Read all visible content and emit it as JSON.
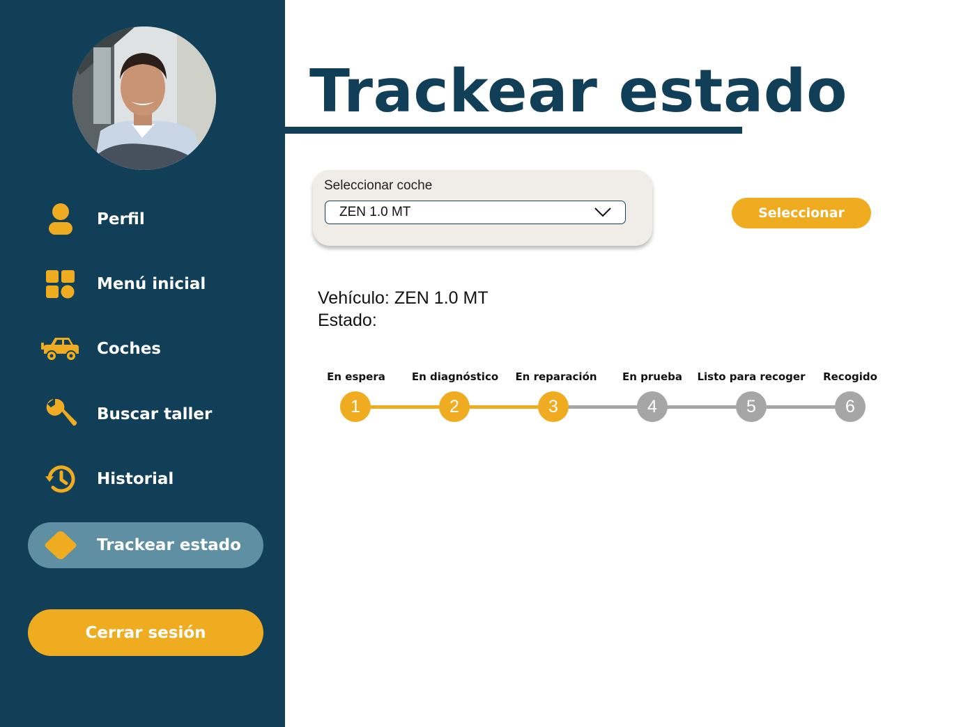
{
  "colors": {
    "sidebar_bg": "#113f57",
    "accent": "#f0ac20",
    "active_item_bg": "#5e8fa3",
    "title": "#113f57",
    "step_inactive": "#a6a6a6"
  },
  "sidebar": {
    "avatar_icon": "driver-photo",
    "items": [
      {
        "label": "Perfil",
        "icon": "user-icon",
        "active": false
      },
      {
        "label": "Menú inicial",
        "icon": "grid-icon",
        "active": false
      },
      {
        "label": "Coches",
        "icon": "car-icon",
        "active": false
      },
      {
        "label": "Buscar taller",
        "icon": "wrench-icon",
        "active": false
      },
      {
        "label": "Historial",
        "icon": "history-icon",
        "active": false
      },
      {
        "label": "Trackear estado",
        "icon": "diamond-icon",
        "active": true
      }
    ],
    "logout_label": "Cerrar sesión"
  },
  "main": {
    "title": "Trackear estado",
    "car_select": {
      "label": "Seleccionar coche",
      "value": "ZEN 1.0 MT"
    },
    "select_button": "Seleccionar",
    "vehicle": {
      "label": "Vehículo:",
      "value": "ZEN 1.0 MT"
    },
    "status": {
      "label": "Estado:"
    },
    "steps": [
      {
        "number": "1",
        "label": "En espera"
      },
      {
        "number": "2",
        "label": "En diagnóstico"
      },
      {
        "number": "3",
        "label": "En reparación"
      },
      {
        "number": "4",
        "label": "En prueba"
      },
      {
        "number": "5",
        "label": "Listo para recoger"
      },
      {
        "number": "6",
        "label": "Recogido"
      }
    ],
    "completed_steps": 3
  }
}
